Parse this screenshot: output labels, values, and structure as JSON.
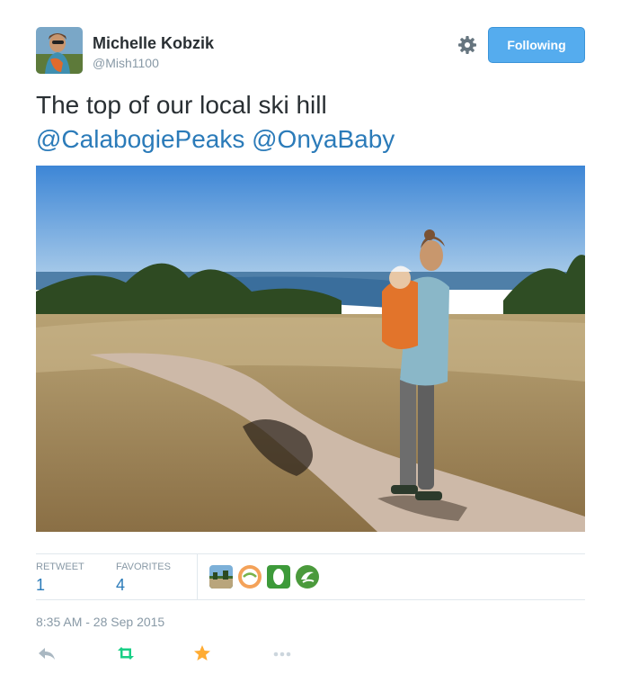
{
  "user": {
    "name": "Michelle Kobzik",
    "handle": "@Mish1100",
    "follow_label": "Following"
  },
  "tweet": {
    "text_plain": "The top of our local ski hill",
    "mention_1": "@CalabogiePeaks",
    "mention_2": "@OnyaBaby"
  },
  "stats": {
    "retweet_label": "RETWEET",
    "retweet_count": "1",
    "favorites_label": "FAVORITES",
    "favorites_count": "4"
  },
  "favoriters": [
    "landscape-avatar",
    "onya-logo-avatar",
    "green-leaf-avatar",
    "green-swirl-avatar"
  ],
  "timestamp": "8:35 AM - 28 Sep 2015",
  "colors": {
    "link": "#2b7bb9",
    "button": "#55acee",
    "retweet": "#19cf86",
    "favorite": "#ffac33",
    "muted": "#8899a6"
  },
  "icons": [
    "gear-icon",
    "reply-icon",
    "retweet-icon",
    "favorite-icon",
    "more-icon"
  ]
}
